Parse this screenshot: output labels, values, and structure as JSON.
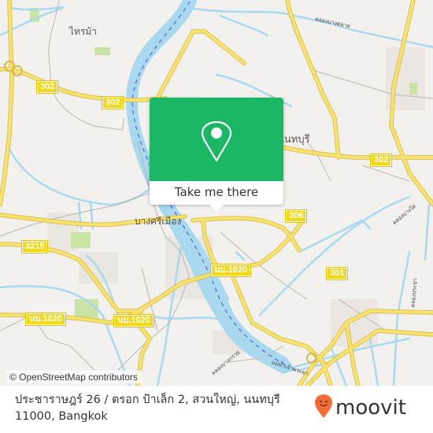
{
  "map": {
    "places": [
      {
        "id": "sai-ma",
        "label": "ไทรม้า"
      },
      {
        "id": "nonthaburi",
        "label": "นนทบุรี"
      },
      {
        "id": "bang-si-mueang",
        "label": "บางศรีเมือง"
      }
    ],
    "route_shields": [
      {
        "id": "302-west",
        "label": "302"
      },
      {
        "id": "302-center",
        "label": "302"
      },
      {
        "id": "302-east",
        "label": "302"
      },
      {
        "id": "306",
        "label": "306"
      },
      {
        "id": "301",
        "label": "301"
      },
      {
        "id": "3215",
        "label": "3215"
      },
      {
        "id": "1020-west",
        "label": "นบ.1020"
      },
      {
        "id": "1020-mid",
        "label": "นบ.1020"
      },
      {
        "id": "1020-east",
        "label": "นบ.1020"
      }
    ],
    "road_labels": [
      {
        "id": "canal-top",
        "label": "คลองบางตลาด"
      },
      {
        "id": "canal-east",
        "label": "คลองบางไผ่"
      },
      {
        "id": "canal-east-2",
        "label": "คลองประปา"
      },
      {
        "id": "canal-south",
        "label": "คลองบางกรวย"
      },
      {
        "id": "river-label",
        "label": "แม่น้ำเจ้าพระยา"
      }
    ],
    "attribution": "© OpenStreetMap contributors",
    "colors": {
      "land": "#f2f1ed",
      "water": "#a8d9ef",
      "road": "#f8e46c",
      "route_shield": "#f3d816",
      "popup_green": "#1bb765",
      "brand_orange": "#f26a36"
    }
  },
  "popup": {
    "button_label": "Take me there",
    "icon": "map-pin-icon"
  },
  "footer": {
    "address": "ประชาราษฎร์ 26 / ตรอก ป้าเล็ก 2, สวนใหญ่, นนทบุรี 11000, Bangkok",
    "brand": "moovit"
  }
}
